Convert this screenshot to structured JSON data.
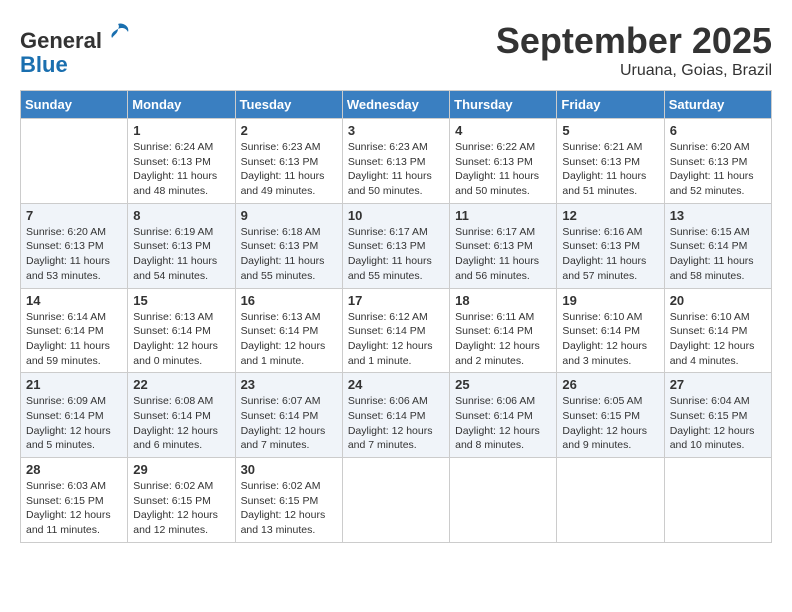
{
  "header": {
    "logo_general": "General",
    "logo_blue": "Blue",
    "month": "September 2025",
    "location": "Uruana, Goias, Brazil"
  },
  "days_of_week": [
    "Sunday",
    "Monday",
    "Tuesday",
    "Wednesday",
    "Thursday",
    "Friday",
    "Saturday"
  ],
  "weeks": [
    [
      {
        "day": "",
        "info": ""
      },
      {
        "day": "1",
        "info": "Sunrise: 6:24 AM\nSunset: 6:13 PM\nDaylight: 11 hours\nand 48 minutes."
      },
      {
        "day": "2",
        "info": "Sunrise: 6:23 AM\nSunset: 6:13 PM\nDaylight: 11 hours\nand 49 minutes."
      },
      {
        "day": "3",
        "info": "Sunrise: 6:23 AM\nSunset: 6:13 PM\nDaylight: 11 hours\nand 50 minutes."
      },
      {
        "day": "4",
        "info": "Sunrise: 6:22 AM\nSunset: 6:13 PM\nDaylight: 11 hours\nand 50 minutes."
      },
      {
        "day": "5",
        "info": "Sunrise: 6:21 AM\nSunset: 6:13 PM\nDaylight: 11 hours\nand 51 minutes."
      },
      {
        "day": "6",
        "info": "Sunrise: 6:20 AM\nSunset: 6:13 PM\nDaylight: 11 hours\nand 52 minutes."
      }
    ],
    [
      {
        "day": "7",
        "info": "Sunrise: 6:20 AM\nSunset: 6:13 PM\nDaylight: 11 hours\nand 53 minutes."
      },
      {
        "day": "8",
        "info": "Sunrise: 6:19 AM\nSunset: 6:13 PM\nDaylight: 11 hours\nand 54 minutes."
      },
      {
        "day": "9",
        "info": "Sunrise: 6:18 AM\nSunset: 6:13 PM\nDaylight: 11 hours\nand 55 minutes."
      },
      {
        "day": "10",
        "info": "Sunrise: 6:17 AM\nSunset: 6:13 PM\nDaylight: 11 hours\nand 55 minutes."
      },
      {
        "day": "11",
        "info": "Sunrise: 6:17 AM\nSunset: 6:13 PM\nDaylight: 11 hours\nand 56 minutes."
      },
      {
        "day": "12",
        "info": "Sunrise: 6:16 AM\nSunset: 6:13 PM\nDaylight: 11 hours\nand 57 minutes."
      },
      {
        "day": "13",
        "info": "Sunrise: 6:15 AM\nSunset: 6:14 PM\nDaylight: 11 hours\nand 58 minutes."
      }
    ],
    [
      {
        "day": "14",
        "info": "Sunrise: 6:14 AM\nSunset: 6:14 PM\nDaylight: 11 hours\nand 59 minutes."
      },
      {
        "day": "15",
        "info": "Sunrise: 6:13 AM\nSunset: 6:14 PM\nDaylight: 12 hours\nand 0 minutes."
      },
      {
        "day": "16",
        "info": "Sunrise: 6:13 AM\nSunset: 6:14 PM\nDaylight: 12 hours\nand 1 minute."
      },
      {
        "day": "17",
        "info": "Sunrise: 6:12 AM\nSunset: 6:14 PM\nDaylight: 12 hours\nand 1 minute."
      },
      {
        "day": "18",
        "info": "Sunrise: 6:11 AM\nSunset: 6:14 PM\nDaylight: 12 hours\nand 2 minutes."
      },
      {
        "day": "19",
        "info": "Sunrise: 6:10 AM\nSunset: 6:14 PM\nDaylight: 12 hours\nand 3 minutes."
      },
      {
        "day": "20",
        "info": "Sunrise: 6:10 AM\nSunset: 6:14 PM\nDaylight: 12 hours\nand 4 minutes."
      }
    ],
    [
      {
        "day": "21",
        "info": "Sunrise: 6:09 AM\nSunset: 6:14 PM\nDaylight: 12 hours\nand 5 minutes."
      },
      {
        "day": "22",
        "info": "Sunrise: 6:08 AM\nSunset: 6:14 PM\nDaylight: 12 hours\nand 6 minutes."
      },
      {
        "day": "23",
        "info": "Sunrise: 6:07 AM\nSunset: 6:14 PM\nDaylight: 12 hours\nand 7 minutes."
      },
      {
        "day": "24",
        "info": "Sunrise: 6:06 AM\nSunset: 6:14 PM\nDaylight: 12 hours\nand 7 minutes."
      },
      {
        "day": "25",
        "info": "Sunrise: 6:06 AM\nSunset: 6:14 PM\nDaylight: 12 hours\nand 8 minutes."
      },
      {
        "day": "26",
        "info": "Sunrise: 6:05 AM\nSunset: 6:15 PM\nDaylight: 12 hours\nand 9 minutes."
      },
      {
        "day": "27",
        "info": "Sunrise: 6:04 AM\nSunset: 6:15 PM\nDaylight: 12 hours\nand 10 minutes."
      }
    ],
    [
      {
        "day": "28",
        "info": "Sunrise: 6:03 AM\nSunset: 6:15 PM\nDaylight: 12 hours\nand 11 minutes."
      },
      {
        "day": "29",
        "info": "Sunrise: 6:02 AM\nSunset: 6:15 PM\nDaylight: 12 hours\nand 12 minutes."
      },
      {
        "day": "30",
        "info": "Sunrise: 6:02 AM\nSunset: 6:15 PM\nDaylight: 12 hours\nand 13 minutes."
      },
      {
        "day": "",
        "info": ""
      },
      {
        "day": "",
        "info": ""
      },
      {
        "day": "",
        "info": ""
      },
      {
        "day": "",
        "info": ""
      }
    ]
  ]
}
